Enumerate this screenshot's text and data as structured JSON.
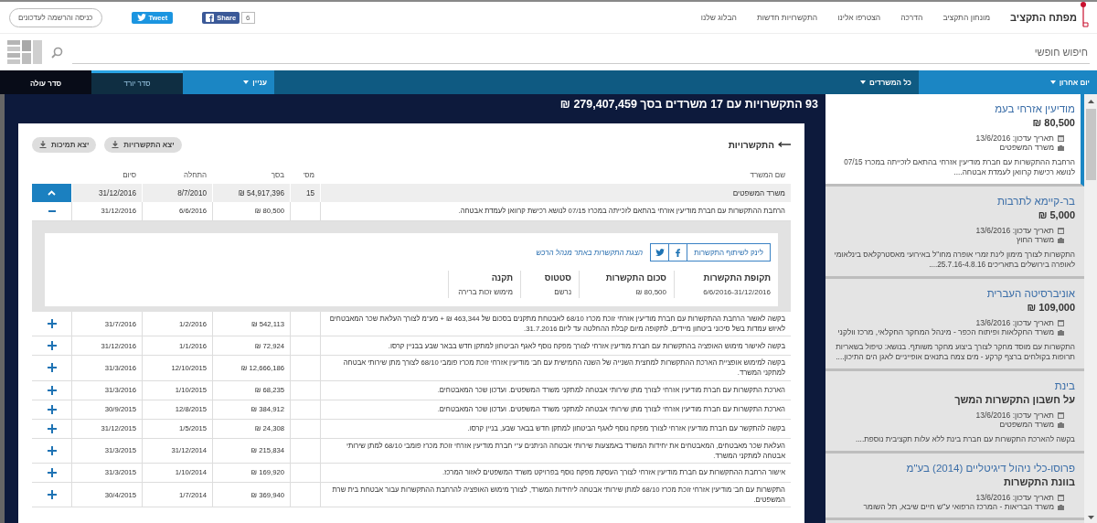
{
  "top_nav": {
    "logo": "מפתח התקציב",
    "links": [
      "מונחון התקציב",
      "הדרכה",
      "הצטרפו אלינו",
      "התקשרויות חדשות",
      "הבלוג שלנו"
    ],
    "share_count": "6",
    "share": "Share",
    "tweet": "Tweet",
    "register": "כניסה והרשמה לעדכונים"
  },
  "search": {
    "placeholder": "חיפוש חופשי"
  },
  "filter_bar": [
    {
      "kind": "dropdown",
      "label": "יום אחרון",
      "active": true
    },
    {
      "kind": "dropdown",
      "label": "כל המשרדים",
      "active": false
    },
    {
      "kind": "dropdown",
      "label": "עניין",
      "active": true
    },
    {
      "kind": "sort",
      "label": "סדר יורד",
      "selected": true
    },
    {
      "kind": "sort",
      "label": "סדר עולה",
      "selected": false
    }
  ],
  "summary": "93 התקשרויות עם 17 משרדים בסך 279,407,459 ₪",
  "contracts_panel": {
    "title": "התקשרויות",
    "export_buttons": [
      "יצא התקשרויות",
      "יצא תמיכות"
    ],
    "columns": [
      "שם המשרד",
      "מס'",
      "בסך",
      "התחלה",
      "סיום"
    ],
    "ministry": {
      "name": "משרד המשפטים",
      "count": "15",
      "amount": "54,917,396 ₪",
      "start": "8/7/2010",
      "end": "31/12/2016",
      "expanded": true
    },
    "rows": [
      {
        "description": "הרחבת ההתקשרות עם חברת מודיעין אזרחי בהתאם לזכייתה במכרז 07/15 לנושא רכישת קרוואן לעמדת אבטחה.",
        "amount": "80,500 ₪",
        "start": "6/6/2016",
        "end": "31/12/2016",
        "expanded": true,
        "detail": {
          "share_link": "לינק לשיתוף התקשרות",
          "source_link": "הצגת התקשרות באתר מנהל הרכש",
          "fields": [
            {
              "label": "תקופת התקשרות",
              "value": "6/6/2016-31/12/2016"
            },
            {
              "label": "סכום התקשרות",
              "value": "80,500 ₪"
            },
            {
              "label": "סטטוס",
              "value": "נרשם"
            },
            {
              "label": "תקנה",
              "value": "מימוש זכות ברירה"
            }
          ]
        }
      },
      {
        "description": "בקשה לאשור הרחבת ההתקשרות עם חברת מודיעין אזרחי זוכת מכרז 68/10 לאבטחת מתקנים בסכום של 463,344 ₪ + מע\"מ לצורך העלאת שכר המאבטחים לאיוש עמדות בשל סיכוני ביטחון מיידים, לתקופה מיום קבלת ההחלטה עד ליום 31.7.2016.",
        "amount": "542,113 ₪",
        "start": "1/2/2016",
        "end": "31/7/2016",
        "expanded": false
      },
      {
        "description": "בקשה לאישור מימוש האופציה בהתקשרות עם חברת מודיעין אזרחי לצורך מפקח נוסף לאגף הביטחון למתקן חדש בבאר שבע בבניין קרסו.",
        "amount": "72,924 ₪",
        "start": "1/1/2016",
        "end": "31/12/2016",
        "expanded": false
      },
      {
        "description": "בקשה למימוש אופציית הארכת ההתקשרות למחצית השנייה של השנה החמישית עם חב' מודיעין אזרחי זוכת מכרז פומבי 68/10 לצורך מתן שירותי אבטחה למתקני המשרד.",
        "amount": "12,666,186 ₪",
        "start": "12/10/2015",
        "end": "31/3/2016",
        "expanded": false
      },
      {
        "description": "הארכת התקשרות עם חברת מודיעין אזרחי לצורך מתן שירותי אבטחה למתקני משרד המשפטים. ועדכון שכר המאבטחים.",
        "amount": "68,235 ₪",
        "start": "1/10/2015",
        "end": "31/3/2016",
        "expanded": false
      },
      {
        "description": "הארכת התקשרות עם חברת מודיעין אזרחי לצורך מתן שירותי אבטחה למתקני משרד המשפטים. ועדכון שכר המאבטחים.",
        "amount": "384,912 ₪",
        "start": "12/8/2015",
        "end": "30/9/2015",
        "expanded": false
      },
      {
        "description": "בקשה להתקשר עם חברת מודיעין אזרחי לצורך מפקח נוסף לאגף הביטחון למתקן חדש בבאר שבע, בניין קרסו.",
        "amount": "24,308 ₪",
        "start": "1/5/2015",
        "end": "31/12/2015",
        "expanded": false
      },
      {
        "description": "העלאת שכר מאבטחים, המאבטחים את יחידות המשרד באמצעות שירותי אבטחה הניתנים ע\"י חברת מודיעין אזרחי זוכת מכרז פומבי 68/10 למתן שירותי אבטחה למתקני המשרד.",
        "amount": "215,834 ₪",
        "start": "31/12/2014",
        "end": "31/3/2015",
        "expanded": false
      },
      {
        "description": "אישור הרחבת ההתקשרות עם חברת מודיעין אזרחי לצורך העסקת מפקח נוסף בפרויקט משרד המשפטים לאזור המרכז.",
        "amount": "169,920 ₪",
        "start": "1/10/2014",
        "end": "31/3/2015",
        "expanded": false
      },
      {
        "description": "התקשרות עם חב' מודיעין אזרחי זוכת מכרז 68/10 למתן שירותי אבטחה ליחידות המשרד, לצורך מימוש האופציה להרחבת ההתקשרות עבור אבטחת בית שרת המשפטים.",
        "amount": "369,940 ₪",
        "start": "1/7/2014",
        "end": "30/4/2015",
        "expanded": false
      }
    ]
  },
  "sidebar": {
    "cards": [
      {
        "title": "מודיעין אזרחי בעמ",
        "headline": "80,500 ₪",
        "updated": "תאריך עדכון: 13/6/2016",
        "ministry": "משרד המשפטים",
        "description": "הרחבת ההתקשרות עם חברת מודיעין אזרחי בהתאם לזכייתה במכרז 07/15 לנושא רכישת קרוואן לעמדת אבטחה....",
        "selected": true
      },
      {
        "title": "בר-קיימא לתרבות",
        "headline": "5,000 ₪",
        "updated": "תאריך עדכון: 13/6/2016",
        "ministry": "משרד החוץ",
        "description": "התקשרות לצורך מימון לינת זמרי אופרה מחו\"ל באירועי מאסטרקלאס בינלאומי לאופרה בירושלים בתאריכים 25.7.16-4.8.16....",
        "selected": false
      },
      {
        "title": "אוניברסיטה העברית",
        "headline": "109,000 ₪",
        "updated": "תאריך עדכון: 13/6/2016",
        "ministry": "משרד החקלאות ופיתוח הכפר - מינהל המחקר החקלאי, מרכז וולקני",
        "description": "התקשרות עם מוסד מחקר לצורך ביצוע מחקר משותף. בנושא: טיפול בשאריות תרופות בקולחים ברצף קרקע - מים צמח בתנאים אופייניים לאגן הים התיכון....",
        "selected": false
      },
      {
        "title": "בינת",
        "headline": "על חשבון התקשרות המשך",
        "updated": "תאריך עדכון: 13/6/2016",
        "ministry": "משרד המשפטים",
        "description": "בקשה להארכת התקשרות עם חברת בינת ללא עלות תקציבית נוספת....",
        "selected": false
      },
      {
        "title": "פרוסו-כלי ניהול דיגיטליים (2014) בע\"מ",
        "headline": "בוונת התקשרות",
        "updated": "תאריך עדכון: 13/6/2016",
        "ministry": "משרד הבריאות - המרכז הרפואי ע\"ש חיים שיבא, תל השומר",
        "selected": false
      }
    ]
  }
}
